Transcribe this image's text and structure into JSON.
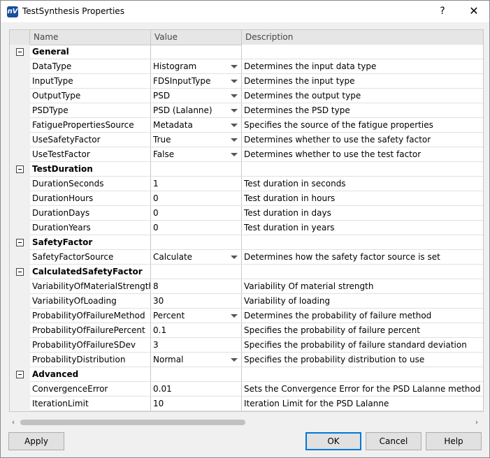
{
  "window": {
    "title": "TestSynthesis Properties",
    "help": "?",
    "close": "✕",
    "app_icon": "nV"
  },
  "grid": {
    "headers": {
      "name": "Name",
      "value": "Value",
      "description": "Description"
    },
    "rows": [
      {
        "type": "category",
        "name": "General",
        "value": "",
        "desc": ""
      },
      {
        "type": "prop",
        "name": "DataType",
        "value": "Histogram",
        "desc": "Determines the input data type",
        "dropdown": true
      },
      {
        "type": "prop",
        "name": "InputType",
        "value": "FDSInputType",
        "desc": "Determines the input type",
        "dropdown": true
      },
      {
        "type": "prop",
        "name": "OutputType",
        "value": "PSD",
        "desc": "Determines the output type",
        "dropdown": true
      },
      {
        "type": "prop",
        "name": "PSDType",
        "value": "PSD (Lalanne)",
        "desc": "Determines the PSD type",
        "dropdown": true
      },
      {
        "type": "prop",
        "name": "FatiguePropertiesSource",
        "value": "Metadata",
        "desc": "Specifies the source of the fatigue properties",
        "dropdown": true
      },
      {
        "type": "prop",
        "name": "UseSafetyFactor",
        "value": "True",
        "desc": "Determines whether to use the safety factor",
        "dropdown": true
      },
      {
        "type": "prop",
        "name": "UseTestFactor",
        "value": "False",
        "desc": "Determines whether to use the test factor",
        "dropdown": true
      },
      {
        "type": "category",
        "name": "TestDuration",
        "value": "",
        "desc": ""
      },
      {
        "type": "prop",
        "name": "DurationSeconds",
        "value": "1",
        "desc": "Test duration in seconds",
        "dropdown": false
      },
      {
        "type": "prop",
        "name": "DurationHours",
        "value": "0",
        "desc": "Test duration in hours",
        "dropdown": false
      },
      {
        "type": "prop",
        "name": "DurationDays",
        "value": "0",
        "desc": "Test duration in days",
        "dropdown": false
      },
      {
        "type": "prop",
        "name": "DurationYears",
        "value": "0",
        "desc": "Test duration in years",
        "dropdown": false
      },
      {
        "type": "category",
        "name": "SafetyFactor",
        "value": "",
        "desc": ""
      },
      {
        "type": "prop",
        "name": "SafetyFactorSource",
        "value": "Calculate",
        "desc": "Determines how the safety factor source is set",
        "dropdown": true
      },
      {
        "type": "category",
        "name": "CalculatedSafetyFactor",
        "value": "",
        "desc": ""
      },
      {
        "type": "prop",
        "name": "VariabilityOfMaterialStrength",
        "value": "8",
        "desc": "Variability Of material strength",
        "dropdown": false
      },
      {
        "type": "prop",
        "name": "VariabilityOfLoading",
        "value": "30",
        "desc": "Variability of loading",
        "dropdown": false
      },
      {
        "type": "prop",
        "name": "ProbabilityOfFailureMethod",
        "value": "Percent",
        "desc": "Determines the probability of failure method",
        "dropdown": true
      },
      {
        "type": "prop",
        "name": "ProbabilityOfFailurePercent",
        "value": "0.1",
        "desc": "Specifies the probability of failure percent",
        "dropdown": false
      },
      {
        "type": "prop",
        "name": "ProbabilityOfFailureSDev",
        "value": "3",
        "desc": "Specifies the probability of failure standard deviation",
        "dropdown": false
      },
      {
        "type": "prop",
        "name": "ProbabilityDistribution",
        "value": "Normal",
        "desc": "Specifies the probability distribution to use",
        "dropdown": true
      },
      {
        "type": "category",
        "name": "Advanced",
        "value": "",
        "desc": ""
      },
      {
        "type": "prop",
        "name": "ConvergenceError",
        "value": "0.01",
        "desc": "Sets the Convergence Error for the PSD Lalanne method",
        "dropdown": false
      },
      {
        "type": "prop",
        "name": "IterationLimit",
        "value": "10",
        "desc": "Iteration Limit for the PSD Lalanne",
        "dropdown": false
      }
    ]
  },
  "scrollbar": {
    "left_arrow": "‹",
    "right_arrow": "›"
  },
  "buttons": {
    "apply": "Apply",
    "ok": "OK",
    "cancel": "Cancel",
    "help": "Help"
  }
}
